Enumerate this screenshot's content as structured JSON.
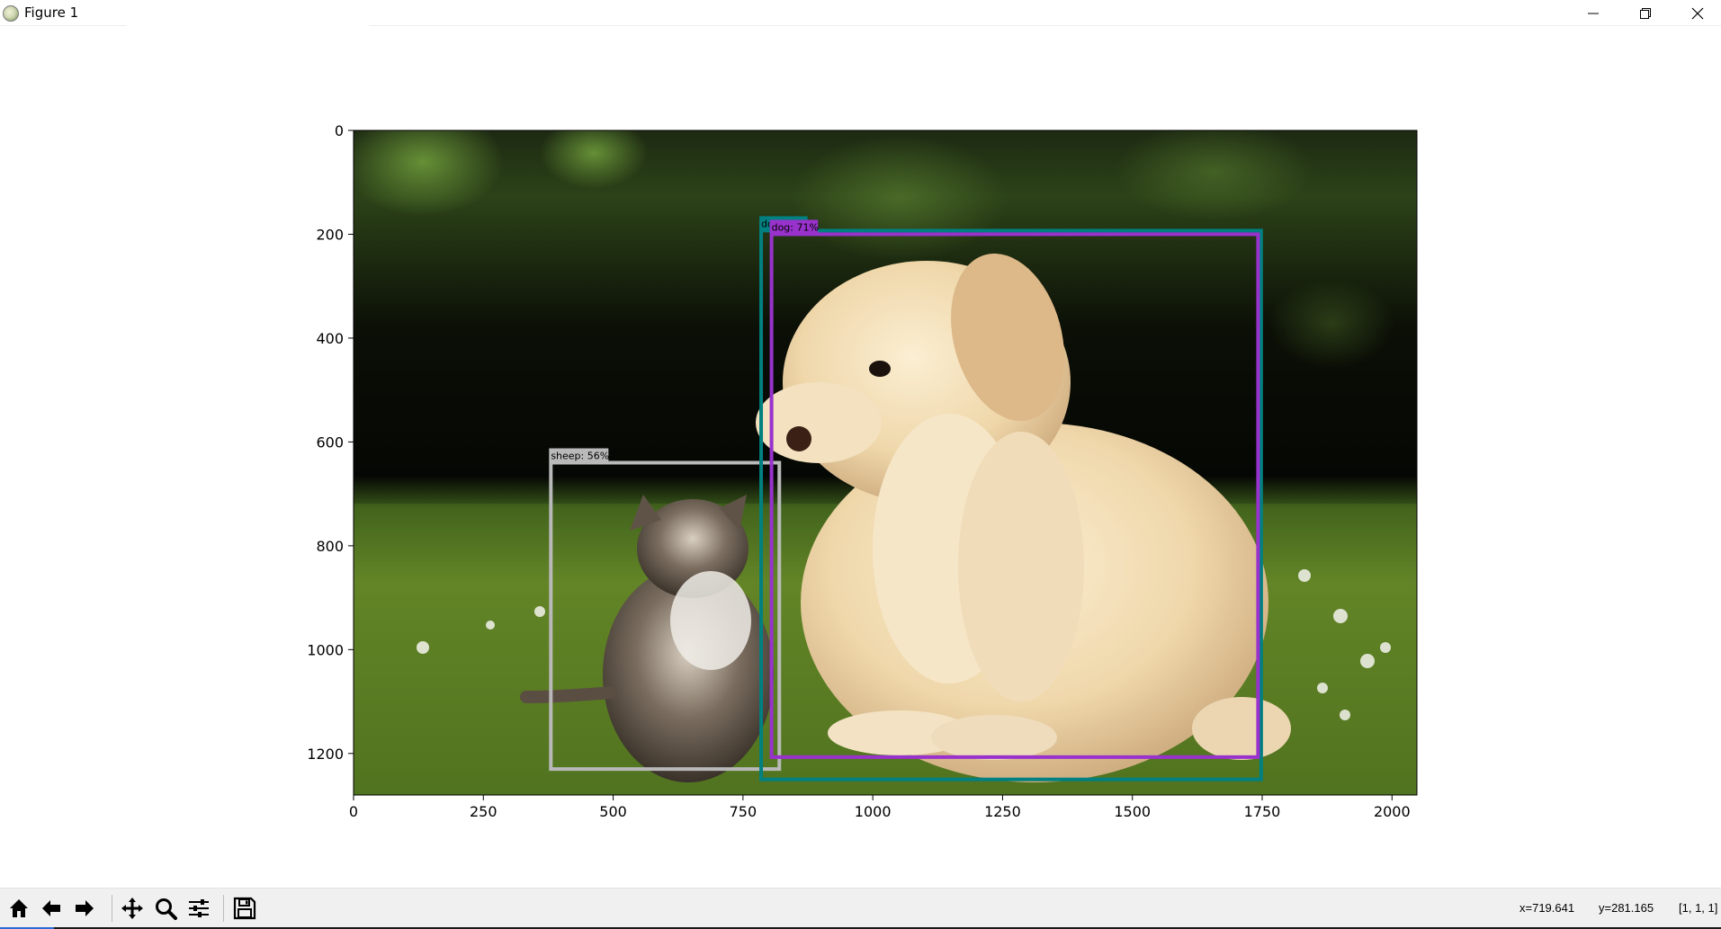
{
  "window": {
    "title": "Figure 1",
    "app_icon": "matplotlib-icon",
    "controls": [
      "minimize-icon",
      "maximize-icon",
      "close-icon"
    ]
  },
  "figure": {
    "image_description_visible": false,
    "x_ticks": [
      "0",
      "250",
      "500",
      "750",
      "1000",
      "1250",
      "1500",
      "1750",
      "2000"
    ],
    "y_ticks": [
      "0",
      "200",
      "400",
      "600",
      "800",
      "1000",
      "1200"
    ],
    "xlim": [
      0,
      2048
    ],
    "ylim": [
      1280,
      0
    ],
    "detections": [
      {
        "label": "sheep: 56%",
        "color": "#b9b9b9",
        "label_text_color": "#000000",
        "xmin": 380,
        "ymin": 640,
        "xmax": 820,
        "ymax": 1230
      },
      {
        "label": "dog: 71%",
        "color": "#008080",
        "label_text_color": "#000000",
        "xmin": 785,
        "ymin": 193,
        "xmax": 1748,
        "ymax": 1250
      },
      {
        "label": "dog: 71%",
        "color": "#9932cc",
        "label_text_color": "#000000",
        "xmin": 805,
        "ymin": 200,
        "xmax": 1742,
        "ymax": 1207
      }
    ]
  },
  "toolbar": {
    "buttons": [
      {
        "name": "home-button",
        "icon": "home-icon"
      },
      {
        "name": "back-button",
        "icon": "arrow-left-icon"
      },
      {
        "name": "forward-button",
        "icon": "arrow-right-icon"
      },
      {
        "name": "pan-button",
        "icon": "move-icon"
      },
      {
        "name": "zoom-button",
        "icon": "magnifier-icon"
      },
      {
        "name": "configure-subplots-button",
        "icon": "sliders-icon"
      },
      {
        "name": "save-button",
        "icon": "floppy-disk-icon"
      }
    ],
    "status": {
      "x": "x=719.641",
      "y": "y=281.165",
      "pixel": "[1, 1, 1]"
    }
  }
}
